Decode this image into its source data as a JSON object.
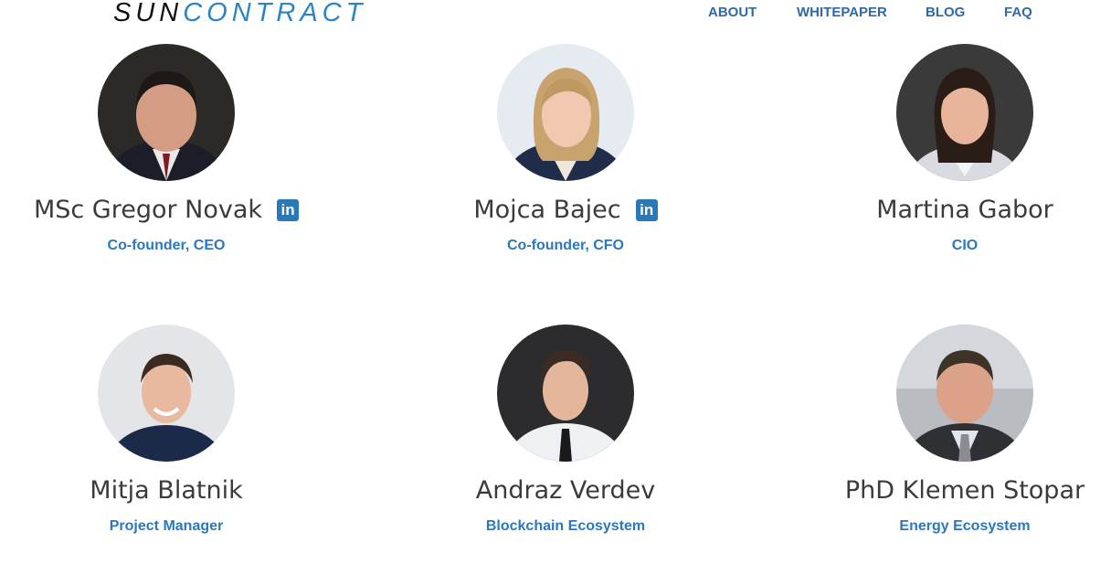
{
  "header": {
    "logo": {
      "part1": "SUN",
      "part2": "CONTRACT"
    },
    "nav": [
      {
        "label": "ABOUT"
      },
      {
        "label": "WHITEPAPER"
      },
      {
        "label": "BLOG"
      },
      {
        "label": "FAQ"
      }
    ]
  },
  "team": [
    {
      "name": "MSc Gregor Novak",
      "role": "Co-founder, CEO",
      "linkedin_icon": "in"
    },
    {
      "name": "Mojca Bajec",
      "role": "Co-founder, CFO",
      "linkedin_icon": "in"
    },
    {
      "name": "Martina Gabor",
      "role": "CIO"
    },
    {
      "name": "Mitja Blatnik",
      "role": "Project Manager"
    },
    {
      "name": "Andraz Verdev",
      "role": "Blockchain Ecosystem"
    },
    {
      "name": "PhD Klemen Stopar",
      "role": "Energy Ecosystem"
    }
  ],
  "colors": {
    "brand_dark": "#111111",
    "brand_blue": "#2a84c6",
    "link": "#2d6aa6",
    "role": "#2a78c0",
    "linkedin": "#2a78b8"
  }
}
